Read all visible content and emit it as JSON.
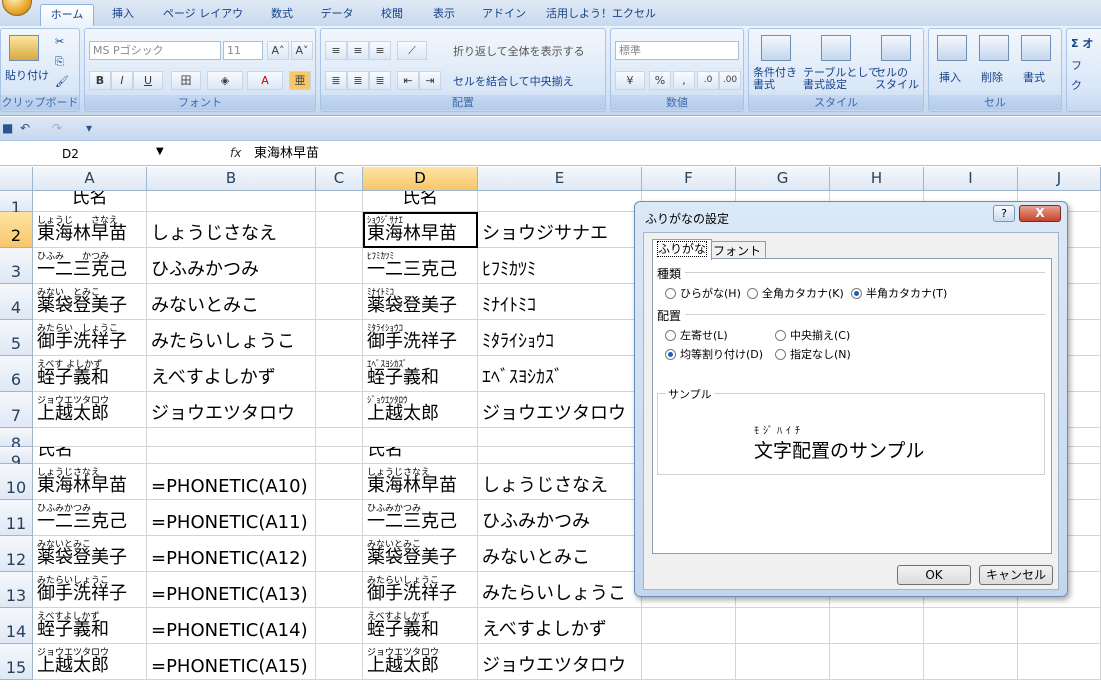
{
  "ribbon": {
    "tabs": [
      "ホーム",
      "挿入",
      "ページ レイアウト",
      "数式",
      "データ",
      "校閲",
      "表示",
      "アドイン",
      "活用しよう！エクセル"
    ],
    "clipboard": {
      "paste": "貼り付け",
      "label": "クリップボード"
    },
    "font": {
      "name": "MS Pゴシック",
      "size": "11",
      "label": "フォント",
      "bold": "B",
      "italic": "I",
      "underline": "U"
    },
    "alignment": {
      "wrap": "折り返して全体を表示する",
      "merge": "セルを結合して中央揃え",
      "label": "配置"
    },
    "number": {
      "format": "標準",
      "label": "数値",
      "percent": "%",
      "comma": ","
    },
    "styles": {
      "conditional": "条件付き\n書式",
      "table": "テーブルとして\n書式設定",
      "cell": "セルの\nスタイル",
      "label": "スタイル"
    },
    "cells": {
      "insert": "挿入",
      "delete": "削除",
      "format": "書式",
      "label": "セル"
    },
    "editing": {
      "sigma": "Σ オ",
      "fill": "フ",
      "clear": "ク"
    }
  },
  "formula_bar": {
    "name_box": "D2",
    "fx": "fx",
    "formula": "東海林早苗"
  },
  "columns": [
    "A",
    "B",
    "C",
    "D",
    "E",
    "F",
    "G",
    "H",
    "I",
    "J"
  ],
  "rows": [
    {
      "n": "1",
      "a": {
        "t": "氏名"
      },
      "b": {
        "t": ""
      },
      "d": {
        "t": "氏名"
      },
      "e": {
        "t": ""
      }
    },
    {
      "n": "2",
      "a": {
        "r": "しょうじ　　さなえ",
        "t": "東海林早苗"
      },
      "b": {
        "t": "しょうじさなえ"
      },
      "d": {
        "r": "ｼｮｳｼﾞｻﾅｴ",
        "t": "東海林早苗"
      },
      "e": {
        "t": "ショウジサナエ"
      }
    },
    {
      "n": "3",
      "a": {
        "r": "ひふみ　　かつみ",
        "t": "一二三克己"
      },
      "b": {
        "t": "ひふみかつみ"
      },
      "d": {
        "r": "ﾋﾌﾐｶﾂﾐ",
        "t": "一二三克己"
      },
      "e": {
        "t": "ﾋﾌﾐｶﾂﾐ"
      }
    },
    {
      "n": "4",
      "a": {
        "r": "みない　とみこ",
        "t": "薬袋登美子"
      },
      "b": {
        "t": "みないとみこ"
      },
      "d": {
        "r": "ﾐﾅｲﾄﾐｺ",
        "t": "薬袋登美子"
      },
      "e": {
        "t": "ﾐﾅｲﾄﾐｺ"
      }
    },
    {
      "n": "5",
      "a": {
        "r": "みたらい　しょうこ",
        "t": "御手洗祥子"
      },
      "b": {
        "t": "みたらいしょうこ"
      },
      "d": {
        "r": "ﾐﾀﾗｲｼｮｳｺ",
        "t": "御手洗祥子"
      },
      "e": {
        "t": "ﾐﾀﾗｲｼｮｳｺ"
      }
    },
    {
      "n": "6",
      "a": {
        "r": "えべす よしかず",
        "t": "蛭子義和"
      },
      "b": {
        "t": "えべすよしかず"
      },
      "d": {
        "r": "ｴﾍﾞｽﾖｼｶｽﾞ",
        "t": "蛭子義和"
      },
      "e": {
        "t": "ｴﾍﾞｽﾖｼｶｽﾞ"
      }
    },
    {
      "n": "7",
      "a": {
        "r": "ジョウエツタロウ",
        "t": "上越太郎"
      },
      "b": {
        "t": "ジョウエツタロウ"
      },
      "d": {
        "r": "ｼﾞｮｳｴﾂﾀﾛｳ",
        "t": "上越太郎"
      },
      "e": {
        "t": "ジョウエツタロウ"
      }
    },
    {
      "n": "8",
      "a": {
        "t": ""
      },
      "b": {
        "t": ""
      },
      "d": {
        "t": ""
      },
      "e": {
        "t": ""
      }
    },
    {
      "n": "9",
      "a": {
        "t": "氏名"
      },
      "b": {
        "t": ""
      },
      "d": {
        "t": "氏名"
      },
      "e": {
        "t": ""
      }
    },
    {
      "n": "10",
      "a": {
        "r": "しょうじさなえ",
        "t": "東海林早苗"
      },
      "b": {
        "t": "=PHONETIC(A10)"
      },
      "d": {
        "r": "しょうじさなえ",
        "t": "東海林早苗"
      },
      "e": {
        "t": "しょうじさなえ"
      }
    },
    {
      "n": "11",
      "a": {
        "r": "ひふみかつみ",
        "t": "一二三克己"
      },
      "b": {
        "t": "=PHONETIC(A11)"
      },
      "d": {
        "r": "ひふみかつみ",
        "t": "一二三克己"
      },
      "e": {
        "t": "ひふみかつみ"
      }
    },
    {
      "n": "12",
      "a": {
        "r": "みないとみこ",
        "t": "薬袋登美子"
      },
      "b": {
        "t": "=PHONETIC(A12)"
      },
      "d": {
        "r": "みないとみこ",
        "t": "薬袋登美子"
      },
      "e": {
        "t": "みないとみこ"
      }
    },
    {
      "n": "13",
      "a": {
        "r": "みたらいしょうこ",
        "t": "御手洗祥子"
      },
      "b": {
        "t": "=PHONETIC(A13)"
      },
      "d": {
        "r": "みたらいしょうこ",
        "t": "御手洗祥子"
      },
      "e": {
        "t": "みたらいしょうこ"
      }
    },
    {
      "n": "14",
      "a": {
        "r": "えべすよしかず",
        "t": "蛭子義和"
      },
      "b": {
        "t": "=PHONETIC(A14)"
      },
      "d": {
        "r": "えべすよしかず",
        "t": "蛭子義和"
      },
      "e": {
        "t": "えべすよしかず"
      }
    },
    {
      "n": "15",
      "a": {
        "r": "ジョウエツタロウ",
        "t": "上越太郎"
      },
      "b": {
        "t": "=PHONETIC(A15)"
      },
      "d": {
        "r": "ジョウエツタロウ",
        "t": "上越太郎"
      },
      "e": {
        "t": "ジョウエツタロウ"
      }
    }
  ],
  "dialog": {
    "title": "ふりがなの設定",
    "help": "?",
    "close": "X",
    "tabs": [
      "ふりがな",
      "フォント"
    ],
    "type_label": "種類",
    "type_options": [
      "ひらがな(H)",
      "全角カタカナ(K)",
      "半角カタカナ(T)"
    ],
    "type_selected": "半角カタカナ(T)",
    "align_label": "配置",
    "align_options": [
      "左寄せ(L)",
      "中央揃え(C)",
      "均等割り付け(D)",
      "指定なし(N)"
    ],
    "align_selected": "均等割り付け(D)",
    "sample_label": "サンプル",
    "sample_ruby": "ﾓｼﾞﾊｲﾁ",
    "sample_text": "文字配置のサンプル",
    "ok": "OK",
    "cancel": "キャンセル"
  }
}
